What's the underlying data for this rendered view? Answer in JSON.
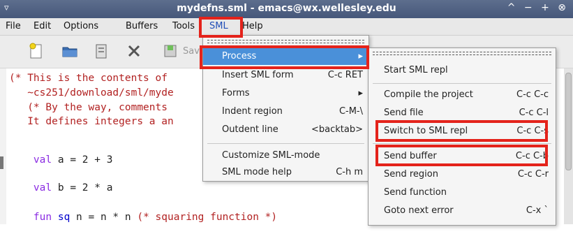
{
  "window": {
    "title": "mydefns.sml - emacs@wx.wellesley.edu",
    "menu_arrow": "▿",
    "controls": "^ − + ⊗"
  },
  "menubar": {
    "items": [
      "File",
      "Edit",
      "Options",
      "Buffers",
      "Tools",
      "SML",
      "Help"
    ]
  },
  "toolbar": {
    "save_label": "Save"
  },
  "editor": {
    "lines": [
      "(* This is the contents of",
      "   ~cs251/download/sml/myde",
      "   (* By the way, comments",
      "   It defines integers a an",
      "val a = 2 + 3",
      "val b = 2 * a",
      "fun sq n = n * n (* squaring function *)"
    ],
    "line4_parts": {
      "kw": "val",
      "rest": " a = 2 + 3"
    },
    "line5_parts": {
      "kw": "val",
      "rest": " b = 2 * a"
    },
    "line6_parts": {
      "kw": "fun",
      "name": " sq",
      "code": " n = n * n ",
      "comment": "(* squaring function *)"
    }
  },
  "sml_menu": {
    "items": [
      {
        "label": "Process",
        "shortcut": "▸",
        "active": true
      },
      {
        "label": "Insert SML form",
        "shortcut": "C-c RET"
      },
      {
        "label": "Forms",
        "shortcut": "▸"
      },
      {
        "label": "Indent region",
        "shortcut": "C-M-\\"
      },
      {
        "label": "Outdent line",
        "shortcut": "<backtab>"
      },
      {
        "label": "Customize SML-mode",
        "shortcut": ""
      },
      {
        "label": "SML mode help",
        "shortcut": "C-h m"
      }
    ]
  },
  "process_menu": {
    "items": [
      {
        "label": "Start SML repl",
        "shortcut": ""
      },
      {
        "label": "Compile the project",
        "shortcut": "C-c C-c"
      },
      {
        "label": "Send file",
        "shortcut": "C-c C-l"
      },
      {
        "label": "Switch to SML repl",
        "shortcut": "C-c C-s"
      },
      {
        "label": "Send buffer",
        "shortcut": "C-c C-b"
      },
      {
        "label": "Send region",
        "shortcut": "C-c C-r"
      },
      {
        "label": "Send function",
        "shortcut": ""
      },
      {
        "label": "Goto next error",
        "shortcut": "C-x `"
      }
    ]
  },
  "colors": {
    "highlight_box": "#e4231b",
    "menu_selection": "#4a90d9",
    "comment": "#b22222",
    "keyword": "#8a2be2",
    "function_name": "#0000cc"
  }
}
